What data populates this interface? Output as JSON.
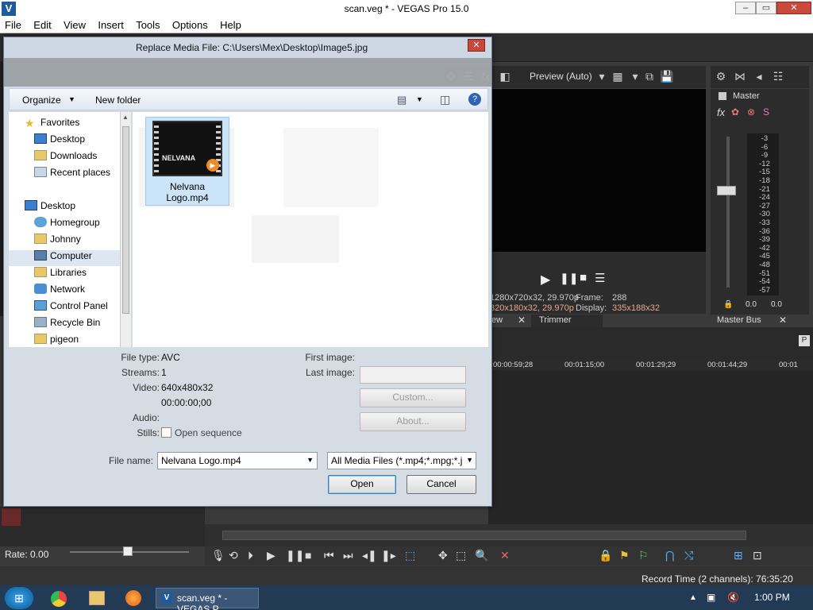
{
  "app": {
    "title": "scan.veg * - VEGAS Pro 15.0",
    "logo": "V"
  },
  "window_controls": {
    "minimize": "–",
    "maximize": "▭",
    "close": "✕"
  },
  "menu": [
    "File",
    "Edit",
    "View",
    "Insert",
    "Tools",
    "Options",
    "Help"
  ],
  "dialog": {
    "title": "Replace Media File: C:\\Users\\Mex\\Desktop\\Image5.jpg",
    "close": "✕",
    "organize": "Organize",
    "new_folder": "New folder",
    "nav_items": [
      "Favorites",
      "Desktop",
      "Downloads",
      "Recent places",
      "Desktop",
      "Homegroup",
      "Johnny",
      "Computer",
      "Libraries",
      "Network",
      "Control Panel",
      "Recycle Bin",
      "pigeon"
    ],
    "file": {
      "name": "Nelvana Logo.mp4",
      "name_line1": "Nelvana",
      "name_line2": "Logo.mp4",
      "thumb_text": "NELVANA"
    },
    "details": {
      "file_type_label": "File type:",
      "file_type": "AVC",
      "streams_label": "Streams:",
      "streams": "1",
      "video_label": "Video:",
      "video": "640x480x32",
      "video_duration": "00:00:00;00",
      "audio_label": "Audio:",
      "stills_label": "Stills:",
      "stills_option": "Open sequence",
      "first_image_label": "First image:",
      "last_image_label": "Last image:",
      "custom_button": "Custom...",
      "about_button": "About..."
    },
    "filename_label": "File name:",
    "filename_value": "Nelvana Logo.mp4",
    "filter_value": "All Media Files (*.mp4;*.mpg;*.j",
    "open_button": "Open",
    "cancel_button": "Cancel"
  },
  "preview": {
    "mode": "Preview (Auto)",
    "project_res": "1280x720x32, 29.970p",
    "preview_res": "320x180x32, 29.970p",
    "frame_label": "Frame:",
    "frame": "288",
    "display_label": "Display:",
    "display": "335x188x32"
  },
  "mixer": {
    "master": "Master",
    "scale": [
      "-3",
      "-6",
      "-9",
      "-12",
      "-15",
      "-18",
      "-21",
      "-24",
      "-27",
      "-30",
      "-33",
      "-36",
      "-39",
      "-42",
      "-45",
      "-48",
      "-51",
      "-54",
      "-57"
    ],
    "left_level": "0.0",
    "right_level": "0.0"
  },
  "tabs": {
    "trimmer": "Trimmer",
    "master_bus": "Master Bus",
    "preview_suffix": "ew"
  },
  "ruler": [
    "00:00:59;28",
    "00:01:15;00",
    "00:01:29;29",
    "00:01:44;29",
    "00:01"
  ],
  "status": {
    "rate": "Rate: 0.00",
    "record_time": "Record Time (2 channels): 76:35:20"
  },
  "taskbar": {
    "active_task": "scan.veg * - VEGAS P...",
    "time": "1:00 PM"
  },
  "colors": {
    "accent": "#1e5a9c",
    "selection": "#cce4f7",
    "taskbar": "#233a55"
  }
}
